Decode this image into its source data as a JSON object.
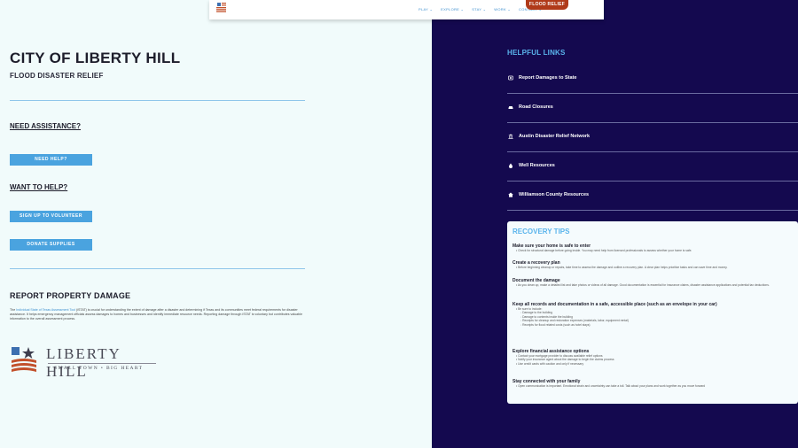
{
  "nav": {
    "items": [
      "PLAY",
      "EXPLORE",
      "STAY",
      "WORK",
      "CONTACT"
    ],
    "cta": "FLOOD RELIEF"
  },
  "page": {
    "title": "CITY OF LIBERTY HILL",
    "subtitle": "FLOOD DISASTER RELIEF"
  },
  "assist": {
    "heading": "NEED ASSISTANCE?",
    "need_help": "NEED HELP?"
  },
  "help": {
    "heading": "WANT TO HELP?",
    "volunteer": "SIGN UP TO VOLUNTEER",
    "donate": "DONATE SUPPLIES"
  },
  "report": {
    "heading": "REPORT PROPERTY DAMAGE",
    "link_text": "Individual State of Texas Assessment Tool",
    "text_before": "The ",
    "text_after": " (iSTAT) is crucial for understanding the extent of damage after a disaster and determining if Texas and its communities meet federal requirements for disaster assistance. It helps emergency management officials assess damages to homes and businesses and identify immediate resource needs. Reporting damage through iSTAT is voluntary but contributes valuable information to the overall assessment process."
  },
  "logo": {
    "name": "LIBERTY HILL",
    "tagline": "SMALL TOWN • BIG HEART"
  },
  "links": {
    "heading": "HELPFUL LINKS",
    "items": [
      {
        "label": "Report Damages to State",
        "icon": "camera-icon"
      },
      {
        "label": "Road Closures",
        "icon": "car-icon"
      },
      {
        "label": "Austin Disaster Relief Network",
        "icon": "building-icon"
      },
      {
        "label": "Well Resources",
        "icon": "droplet-icon"
      },
      {
        "label": "Williamson County Resources",
        "icon": "home-icon"
      }
    ]
  },
  "tips": {
    "heading": "RECOVERY TIPS",
    "t1": {
      "h": "Make sure your home is safe to enter",
      "b1": "Check for structural damage before going inside. You may need help from licensed professionals to assess whether your home is safe."
    },
    "t2": {
      "h": "Create a recovery plan",
      "b1": "Before beginning cleanup or repairs, take time to assess the damage and outline a recovery plan. A clear plan helps prioritize tasks and can save time and money."
    },
    "t3": {
      "h": "Document the damage",
      "b1": "As you clean up, make a detailed list and take photos or videos of all damage. Good documentation is essential for insurance claims, disaster assistance applications and potential tax deductions."
    },
    "t4": {
      "h": "Keep all records and documentation in a safe, accessible place (such as an envelope in your car)",
      "b1": "Be sure to include:",
      "s1": "Damage to the building",
      "s2": "Damage to contents inside the building",
      "s3": "Receipts for cleanup and restoration expenses (materials, labor, equipment rental)",
      "s4": "Receipts for flood related costs (such as hotel stays)"
    },
    "t5": {
      "h": "Explore financial assistance options",
      "b1": "Contact your mortgage provider to discuss available relief options",
      "b2": "Notify your insurance agent about the damage to begin the claims process",
      "b3": "Use credit cards with caution and only if necessary"
    },
    "t6": {
      "h": "Stay connected with your family",
      "b1": "Open communication is important. Emotional strain and uncertainty can take a toll. Talk about your plans and work together as you move forward"
    }
  },
  "colors": {
    "navy": "#14094f",
    "accent_blue": "#4aa3df",
    "cta_red": "#b03a19",
    "background": "#f1fbfb"
  }
}
